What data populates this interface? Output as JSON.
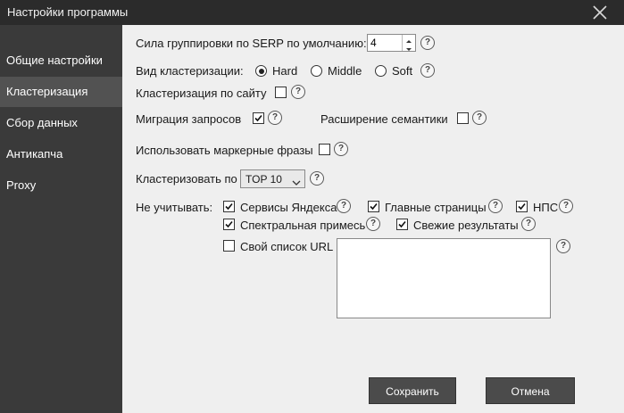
{
  "window": {
    "title": "Настройки программы"
  },
  "sidebar": {
    "items": [
      {
        "label": "Общие настройки"
      },
      {
        "label": "Кластеризация"
      },
      {
        "label": "Сбор данных"
      },
      {
        "label": "Антикапча"
      },
      {
        "label": "Proxy"
      }
    ],
    "active_index": 1
  },
  "settings": {
    "serp_strength": {
      "label": "Сила группировки по SERP по умолчанию:",
      "value": "4"
    },
    "clustering_type": {
      "label": "Вид кластеризации:",
      "options": [
        "Hard",
        "Middle",
        "Soft"
      ],
      "selected": "Hard"
    },
    "cluster_by_site": {
      "label": "Кластеризация по сайту",
      "checked": false
    },
    "query_migration": {
      "label": "Миграция запросов",
      "checked": true
    },
    "semantic_expansion": {
      "label": "Расширение семантики",
      "checked": false
    },
    "marker_phrases": {
      "label": "Использовать маркерные фразы",
      "checked": false
    },
    "cluster_by": {
      "label": "Кластеризовать по",
      "value": "TOP 10"
    },
    "ignore": {
      "label": "Не учитывать:",
      "yandex_services": {
        "label": "Сервисы Яндекса",
        "checked": true
      },
      "main_pages": {
        "label": "Главные страницы",
        "checked": true
      },
      "nps": {
        "label": "НПС",
        "checked": true
      },
      "spectral_admixture": {
        "label": "Спектральная примесь",
        "checked": true
      },
      "fresh_results": {
        "label": "Свежие результаты",
        "checked": true
      },
      "own_url_list": {
        "label": "Свой список URL",
        "checked": false,
        "value": ""
      }
    },
    "help_glyph": "?"
  },
  "buttons": {
    "save": "Сохранить",
    "cancel": "Отмена"
  },
  "colors": {
    "titlebar": "#2b2b2b",
    "sidebar": "#3a3a3a",
    "sidebar_active": "#525252",
    "content": "#efefef",
    "button": "#4b4b4b"
  }
}
